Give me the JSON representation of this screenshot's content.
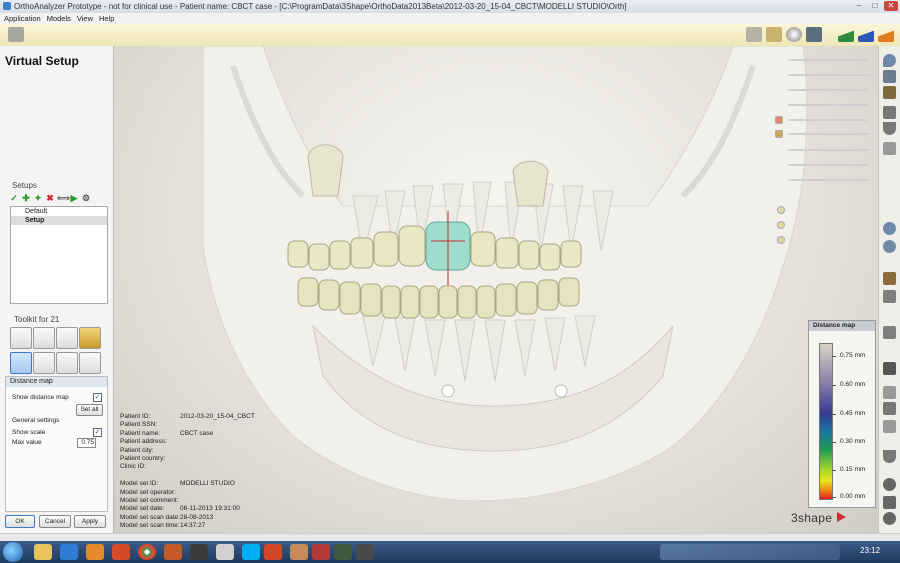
{
  "window": {
    "title": "OrthoAnalyzer Prototype - not for clinical use - Patient name: CBCT case - [C:\\ProgramData\\3Shape\\OrthoData2013Beta\\2012-03-20_15-04_CBCT\\MODELLI STUDIO\\Orth]",
    "controls": {
      "minimize": "–",
      "maximize": "□",
      "close": "✕"
    }
  },
  "menu": [
    "Application",
    "Models",
    "View",
    "Help"
  ],
  "left_panel": {
    "title": "Virtual Setup",
    "setups": {
      "title": "Setups",
      "toolbar_icons": [
        "check-icon",
        "add-icon",
        "thumb-icon",
        "delete-icon",
        "split-icon",
        "play-icon",
        "settings-icon"
      ],
      "items": [
        {
          "label": "Default",
          "selected": false
        },
        {
          "label": "Setup",
          "selected": true
        }
      ]
    },
    "toolkit": {
      "title": "Toolkit for 21"
    },
    "distance_map": {
      "title": "Distance map",
      "show_distance_map_label": "Show distance map",
      "show_distance_map": true,
      "set_all_label": "Set all",
      "general_settings_label": "General settings",
      "show_scale_label": "Show scale",
      "show_scale": true,
      "max_value_label": "Max value",
      "max_value": "0.75"
    },
    "buttons": {
      "ok": "OK",
      "cancel": "Cancel",
      "apply": "Apply"
    }
  },
  "patient_info": [
    {
      "label": "Patient ID:",
      "value": "2012-03-20_15-04_CBCT"
    },
    {
      "label": "Patient SSN:",
      "value": ""
    },
    {
      "label": "Patient name:",
      "value": "CBCT case"
    },
    {
      "label": "Patient address:",
      "value": ""
    },
    {
      "label": "Patient city:",
      "value": ""
    },
    {
      "label": "Patient country:",
      "value": ""
    },
    {
      "label": "Clinic ID:",
      "value": ""
    },
    {
      "label": "",
      "value": ""
    },
    {
      "label": "Model set ID:",
      "value": "MODELLI STUDIO"
    },
    {
      "label": "Model set operator:",
      "value": ""
    },
    {
      "label": "Model set comment:",
      "value": ""
    },
    {
      "label": "Model set date:",
      "value": "06-11-2013 19:31:00"
    },
    {
      "label": "Model set scan date:",
      "value": "28-08-2013"
    },
    {
      "label": "Model set scan time:",
      "value": "14:37:27"
    }
  ],
  "legend": {
    "title": "Distance map",
    "ticks": [
      "0.75 mm",
      "0.60 mm",
      "0.45 mm",
      "0.30 mm",
      "0.15 mm",
      "0.00 mm"
    ]
  },
  "brand": "3shape",
  "taskbar": {
    "clock": "23:12"
  },
  "colors": {
    "tooth": "#e9e7c4",
    "selected_tooth": "#9fdccb",
    "bone": "#f1f0ea"
  }
}
